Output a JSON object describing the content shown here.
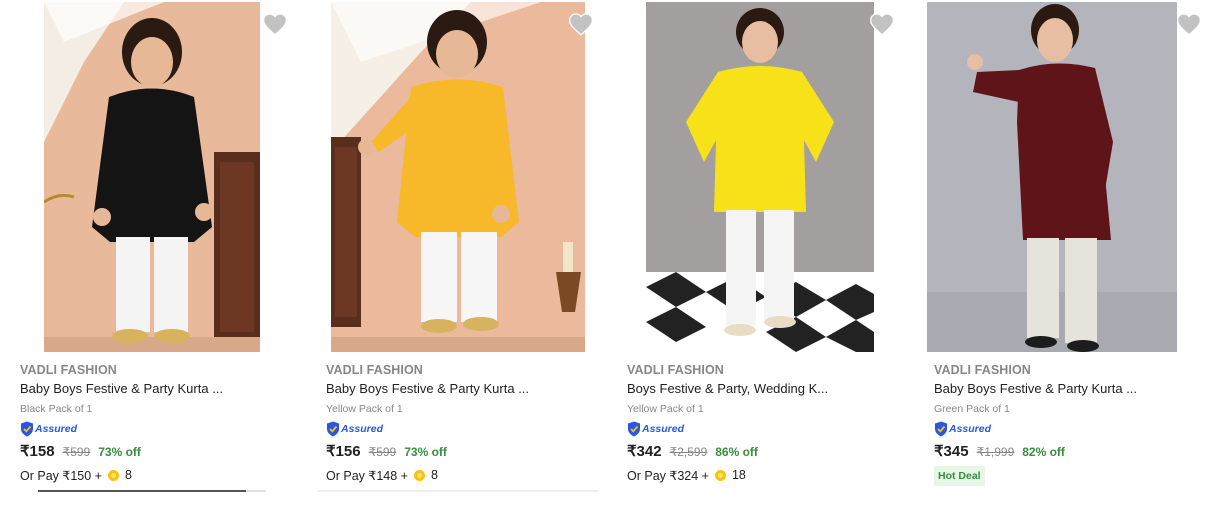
{
  "colors": {
    "accent": "#2a55e5",
    "discount": "#388e3c",
    "muted": "#878787",
    "coin": "#ffc200"
  },
  "products": [
    {
      "brand": "VADLI FASHION",
      "title": "Baby Boys Festive & Party Kurta ...",
      "variant": "Black Pack of 1",
      "assured": "Assured",
      "price": "₹158",
      "mrp": "₹599",
      "discount": "73% off",
      "pay_prefix": "Or Pay ₹150 +",
      "coins": "8",
      "kurta_color": "#141414",
      "bg_color": "#e8b99a",
      "icon": "heart-icon"
    },
    {
      "brand": "VADLI FASHION",
      "title": "Baby Boys Festive & Party Kurta ...",
      "variant": "Yellow Pack of 1",
      "assured": "Assured",
      "price": "₹156",
      "mrp": "₹599",
      "discount": "73% off",
      "pay_prefix": "Or Pay ₹148 +",
      "coins": "8",
      "kurta_color": "#f7b92a",
      "bg_color": "#ebb99c",
      "icon": "heart-icon"
    },
    {
      "brand": "VADLI FASHION",
      "title": "Boys Festive & Party, Wedding K...",
      "variant": "Yellow Pack of 1",
      "assured": "Assured",
      "price": "₹342",
      "mrp": "₹2,599",
      "discount": "86% off",
      "pay_prefix": "Or Pay ₹324 +",
      "coins": "18",
      "kurta_color": "#f7e21a",
      "bg_color": "#a39f9e",
      "icon": "heart-icon"
    },
    {
      "brand": "VADLI FASHION",
      "title": "Baby Boys Festive & Party Kurta ...",
      "variant": "Green Pack of 1",
      "assured": "Assured",
      "price": "₹345",
      "mrp": "₹1,999",
      "discount": "82% off",
      "badge": "Hot Deal",
      "kurta_color": "#5e1418",
      "bg_color": "#b4b4bd",
      "icon": "heart-icon"
    }
  ]
}
